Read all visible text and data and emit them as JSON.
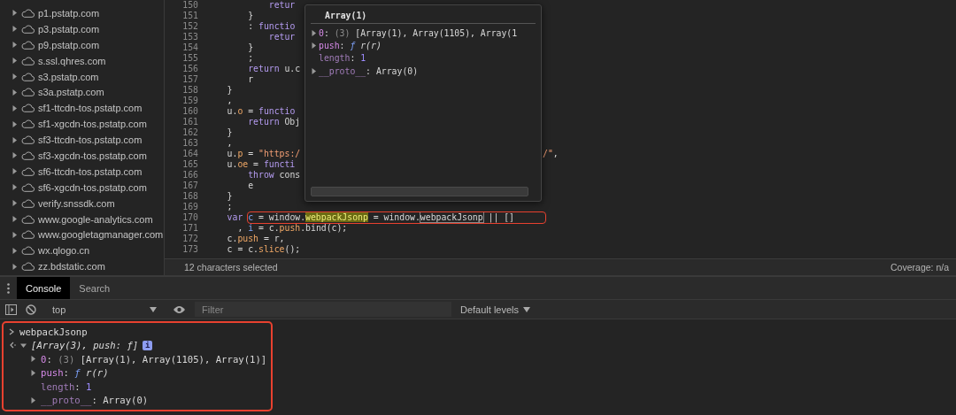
{
  "sidebar": {
    "items": [
      {
        "label": "p1.pstatp.com",
        "expanded": false
      },
      {
        "label": "p3.pstatp.com",
        "expanded": false
      },
      {
        "label": "p9.pstatp.com",
        "expanded": false
      },
      {
        "label": "s.ssl.qhres.com",
        "expanded": false
      },
      {
        "label": "s3.pstatp.com",
        "expanded": false
      },
      {
        "label": "s3a.pstatp.com",
        "expanded": false
      },
      {
        "label": "sf1-ttcdn-tos.pstatp.com",
        "expanded": false
      },
      {
        "label": "sf1-xgcdn-tos.pstatp.com",
        "expanded": false
      },
      {
        "label": "sf3-ttcdn-tos.pstatp.com",
        "expanded": false
      },
      {
        "label": "sf3-xgcdn-tos.pstatp.com",
        "expanded": false
      },
      {
        "label": "sf6-ttcdn-tos.pstatp.com",
        "expanded": false
      },
      {
        "label": "sf6-xgcdn-tos.pstatp.com",
        "expanded": false
      },
      {
        "label": "verify.snssdk.com",
        "expanded": false
      },
      {
        "label": "www.google-analytics.com",
        "expanded": false
      },
      {
        "label": "www.googletagmanager.com",
        "expanded": false
      },
      {
        "label": "wx.qlogo.cn",
        "expanded": false
      },
      {
        "label": "zz.bdstatic.com",
        "expanded": false
      }
    ]
  },
  "editor": {
    "lines": [
      {
        "number": "150",
        "code": [
          {
            "kind": "keyword",
            "text": "            retur"
          }
        ]
      },
      {
        "number": "151",
        "code": [
          {
            "kind": "plain",
            "text": "        }"
          }
        ]
      },
      {
        "number": "152",
        "code": [
          {
            "kind": "plain",
            "text": "        :"
          },
          {
            "kind": "keyword",
            "text": " functio"
          }
        ]
      },
      {
        "number": "153",
        "code": [
          {
            "kind": "keyword",
            "text": "            retur"
          }
        ]
      },
      {
        "number": "154",
        "code": [
          {
            "kind": "plain",
            "text": "        }"
          }
        ]
      },
      {
        "number": "155",
        "code": [
          {
            "kind": "plain",
            "text": "        ;"
          }
        ]
      },
      {
        "number": "156",
        "code": [
          {
            "kind": "keyword",
            "text": "        return"
          },
          {
            "kind": "plain",
            "text": " u.c"
          }
        ]
      },
      {
        "number": "157",
        "code": [
          {
            "kind": "plain",
            "text": "        r"
          }
        ]
      },
      {
        "number": "158",
        "code": [
          {
            "kind": "plain",
            "text": "    }"
          }
        ]
      },
      {
        "number": "159",
        "code": [
          {
            "kind": "plain",
            "text": "    ,"
          }
        ]
      },
      {
        "number": "160",
        "code": [
          {
            "kind": "plain",
            "text": "    u."
          },
          {
            "kind": "property",
            "text": "o"
          },
          {
            "kind": "plain",
            "text": " ="
          },
          {
            "kind": "keyword",
            "text": " functio"
          }
        ]
      },
      {
        "number": "161",
        "code": [
          {
            "kind": "keyword",
            "text": "        return"
          },
          {
            "kind": "plain",
            "text": " Obj"
          }
        ]
      },
      {
        "number": "162",
        "code": [
          {
            "kind": "plain",
            "text": "    }"
          }
        ]
      },
      {
        "number": "163",
        "code": [
          {
            "kind": "plain",
            "text": "    ,"
          }
        ]
      },
      {
        "number": "164",
        "code": [
          {
            "kind": "plain",
            "text": "    u."
          },
          {
            "kind": "property",
            "text": "p"
          },
          {
            "kind": "plain",
            "text": " ="
          },
          {
            "kind": "string",
            "text": " \"https:/"
          }
        ],
        "tail": [
          {
            "kind": "string",
            "text": "/\""
          },
          {
            "kind": "plain",
            "text": ","
          }
        ]
      },
      {
        "number": "165",
        "code": [
          {
            "kind": "plain",
            "text": "    u."
          },
          {
            "kind": "property",
            "text": "oe"
          },
          {
            "kind": "plain",
            "text": " ="
          },
          {
            "kind": "keyword",
            "text": " functi"
          }
        ]
      },
      {
        "number": "166",
        "code": [
          {
            "kind": "keyword",
            "text": "        throw"
          },
          {
            "kind": "plain",
            "text": " cons"
          }
        ]
      },
      {
        "number": "167",
        "code": [
          {
            "kind": "plain",
            "text": "        e"
          }
        ]
      },
      {
        "number": "168",
        "code": [
          {
            "kind": "plain",
            "text": "    }"
          }
        ]
      },
      {
        "number": "169",
        "code": [
          {
            "kind": "plain",
            "text": "    ;"
          }
        ]
      },
      {
        "number": "170",
        "code": [
          {
            "kind": "keyword",
            "text": "    var"
          },
          {
            "kind": "definition",
            "text": " c"
          },
          {
            "kind": "plain",
            "text": " = window."
          },
          {
            "kind": "current_match",
            "text": "webpackJsonp"
          },
          {
            "kind": "plain",
            "text": " = window."
          },
          {
            "kind": "match",
            "text": "webpackJsonp"
          },
          {
            "kind": "plain",
            "text": " || []"
          }
        ]
      },
      {
        "number": "171",
        "code": [
          {
            "kind": "plain",
            "text": "      ,"
          },
          {
            "kind": "definition",
            "text": " i"
          },
          {
            "kind": "plain",
            "text": " = c."
          },
          {
            "kind": "property",
            "text": "push"
          },
          {
            "kind": "plain",
            "text": ".bind(c);"
          }
        ]
      },
      {
        "number": "172",
        "code": [
          {
            "kind": "plain",
            "text": "    c."
          },
          {
            "kind": "property",
            "text": "push"
          },
          {
            "kind": "plain",
            "text": " = r,"
          }
        ]
      },
      {
        "number": "173",
        "code": [
          {
            "kind": "plain",
            "text": "    c = c."
          },
          {
            "kind": "property",
            "text": "slice"
          },
          {
            "kind": "plain",
            "text": "();"
          }
        ]
      }
    ],
    "popover": {
      "title": "Array(1)",
      "rows": [
        {
          "expandable": true,
          "parts": [
            {
              "kind": "key",
              "text": "0"
            },
            {
              "kind": "plain",
              "text": ":"
            },
            {
              "kind": "count",
              "text": " (3)"
            },
            {
              "kind": "plain",
              "text": " [Array(1), Array(1105), Array(1"
            }
          ]
        },
        {
          "expandable": true,
          "parts": [
            {
              "kind": "key",
              "text": "push"
            },
            {
              "kind": "plain",
              "text": ":"
            },
            {
              "kind": "function",
              "text": " ƒ"
            },
            {
              "kind": "italic",
              "text": " r(r)"
            }
          ]
        },
        {
          "expandable": false,
          "parts": [
            {
              "kind": "dim_key",
              "text": "length"
            },
            {
              "kind": "plain",
              "text": ":"
            },
            {
              "kind": "number",
              "text": " 1"
            }
          ]
        },
        {
          "expandable": true,
          "parts": [
            {
              "kind": "dim_key",
              "text": "__proto__"
            },
            {
              "kind": "plain",
              "text": ": Array(0)"
            }
          ]
        }
      ]
    }
  },
  "status_bar": {
    "selection": "12 characters selected",
    "coverage": "Coverage: n/a"
  },
  "drawer": {
    "tabs": [
      {
        "label": "Console",
        "selected": true
      },
      {
        "label": "Search",
        "selected": false
      }
    ]
  },
  "toolbar": {
    "context": "top",
    "filter_placeholder": "Filter",
    "levels": "Default levels"
  },
  "console": {
    "entries": [
      {
        "kind": "input",
        "text": "webpackJsonp"
      },
      {
        "kind": "result",
        "expanded": true,
        "summary": "[Array(3), push: ƒ]",
        "badge": "i",
        "children": [
          {
            "expandable": true,
            "parts": [
              {
                "kind": "key",
                "text": "0"
              },
              {
                "kind": "plain",
                "text": ":"
              },
              {
                "kind": "count",
                "text": " (3)"
              },
              {
                "kind": "plain",
                "text": " [Array(1), Array(1105), Array(1)]"
              }
            ]
          },
          {
            "expandable": true,
            "parts": [
              {
                "kind": "key",
                "text": "push"
              },
              {
                "kind": "plain",
                "text": ":"
              },
              {
                "kind": "function",
                "text": " ƒ"
              },
              {
                "kind": "italic",
                "text": " r(r)"
              }
            ]
          },
          {
            "expandable": false,
            "parts": [
              {
                "kind": "dim_key",
                "text": "length"
              },
              {
                "kind": "plain",
                "text": ":"
              },
              {
                "kind": "number",
                "text": " 1"
              }
            ]
          },
          {
            "expandable": true,
            "parts": [
              {
                "kind": "dim_key",
                "text": "__proto__"
              },
              {
                "kind": "plain",
                "text": ": Array(0)"
              }
            ]
          }
        ]
      }
    ]
  }
}
